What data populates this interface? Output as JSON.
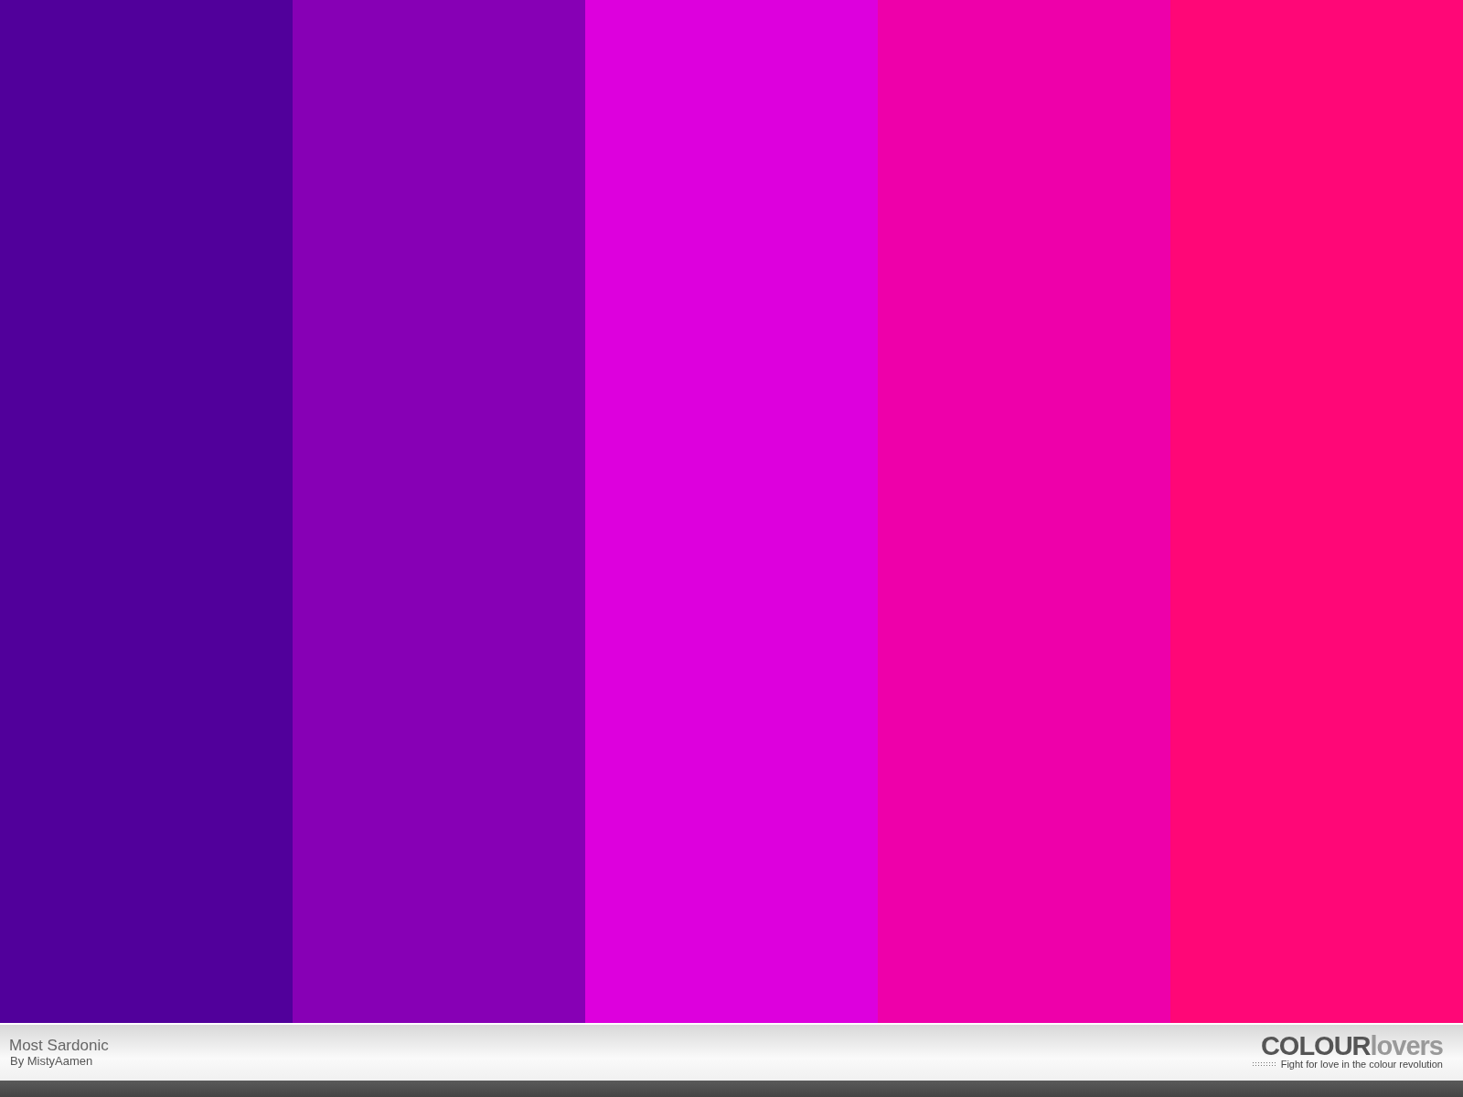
{
  "palette": {
    "swatches": [
      {
        "color": "#51009b"
      },
      {
        "color": "#8700b5"
      },
      {
        "color": "#dd00dd"
      },
      {
        "color": "#ee00aa"
      },
      {
        "color": "#ff0777"
      }
    ]
  },
  "footer": {
    "title": "Most Sardonic",
    "author": "By MistyAamen",
    "logo": {
      "bold_part": "COLOUR",
      "light_part": "lovers"
    },
    "tagline": "Fight for love in the colour revolution"
  }
}
